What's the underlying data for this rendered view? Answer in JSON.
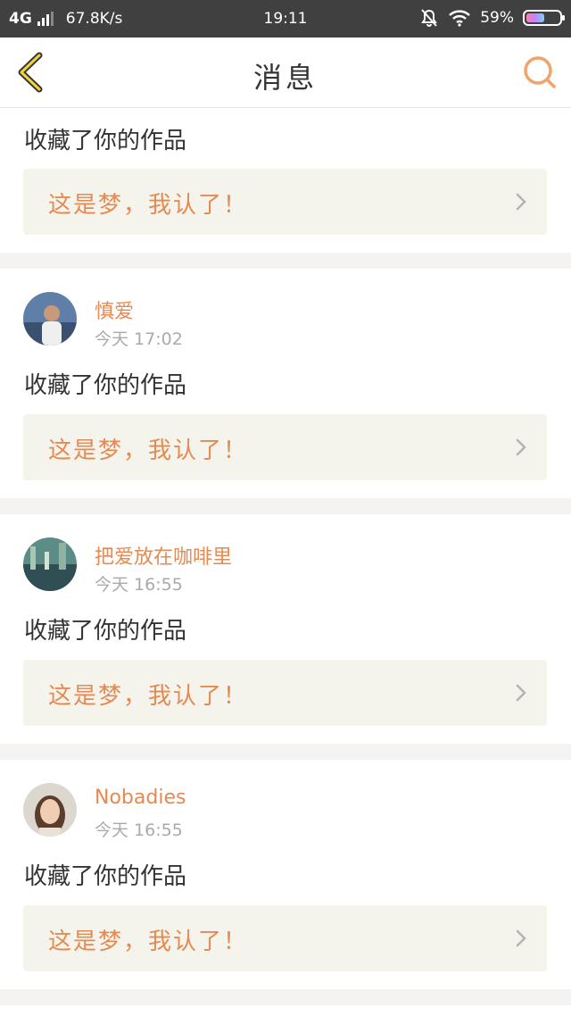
{
  "status_bar": {
    "network": "4G",
    "speed": "67.8K/s",
    "time": "19:11",
    "battery": "59%",
    "battery_level": 0.59
  },
  "header": {
    "title": "消息",
    "icons": {
      "back": "chevron-left-icon",
      "search": "search-icon"
    },
    "accent_color": "#e58a52"
  },
  "messages": [
    {
      "action": "收藏了你的作品",
      "work_title": "这是梦，我认了！"
    },
    {
      "user": "慎爱",
      "time": "今天 17:02",
      "action": "收藏了你的作品",
      "work_title": "这是梦，我认了！"
    },
    {
      "user": "把爱放在咖啡里",
      "time": "今天 16:55",
      "action": "收藏了你的作品",
      "work_title": "这是梦，我认了！"
    },
    {
      "user": "Nobadies",
      "time": "今天 16:55",
      "action": "收藏了你的作品",
      "work_title": "这是梦，我认了！"
    }
  ]
}
